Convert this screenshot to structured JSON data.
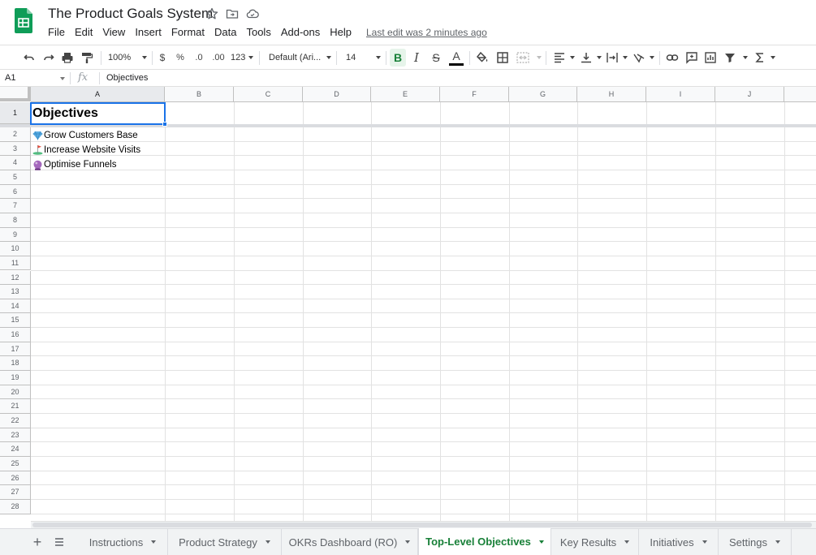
{
  "document": {
    "title": "The Product Goals System",
    "last_edit": "Last edit was 2 minutes ago"
  },
  "menu": [
    "File",
    "Edit",
    "View",
    "Insert",
    "Format",
    "Data",
    "Tools",
    "Add-ons",
    "Help"
  ],
  "toolbar": {
    "zoom": "100%",
    "currency": "$",
    "percent": "%",
    "decrease_decimals": ".0",
    "increase_decimals": ".00",
    "more_formats": "123",
    "font": "Default (Ari...",
    "font_size": "14",
    "bold": "B",
    "italic": "I",
    "strikethrough": "S",
    "text_color": "A"
  },
  "formula_bar": {
    "name_box": "A1",
    "fx": "fx",
    "value": "Objectives"
  },
  "columns": [
    "A",
    "B",
    "C",
    "D",
    "E",
    "F",
    "G",
    "H",
    "I",
    "J"
  ],
  "rows": [
    "1",
    "2",
    "3",
    "4",
    "5",
    "6",
    "7",
    "8",
    "9",
    "10",
    "11",
    "12",
    "13",
    "14",
    "15",
    "16",
    "17",
    "18",
    "19",
    "20",
    "21",
    "22",
    "23",
    "24",
    "25",
    "26",
    "27",
    "28"
  ],
  "cells": {
    "a1": "Objectives",
    "a2": "Grow Customers Base",
    "a3": " Increase Website Visits",
    "a4": "Optimise Funnels"
  },
  "sheet_tabs": [
    "Instructions",
    "Product Strategy",
    "OKRs Dashboard (RO)",
    "Top-Level Objectives",
    "Key Results",
    "Initiatives",
    "Settings"
  ],
  "active_sheet": "Top-Level Objectives",
  "colors": {
    "brand_green": "#188038",
    "selection_blue": "#1a73e8",
    "header_bg": "#f8f9fa"
  }
}
